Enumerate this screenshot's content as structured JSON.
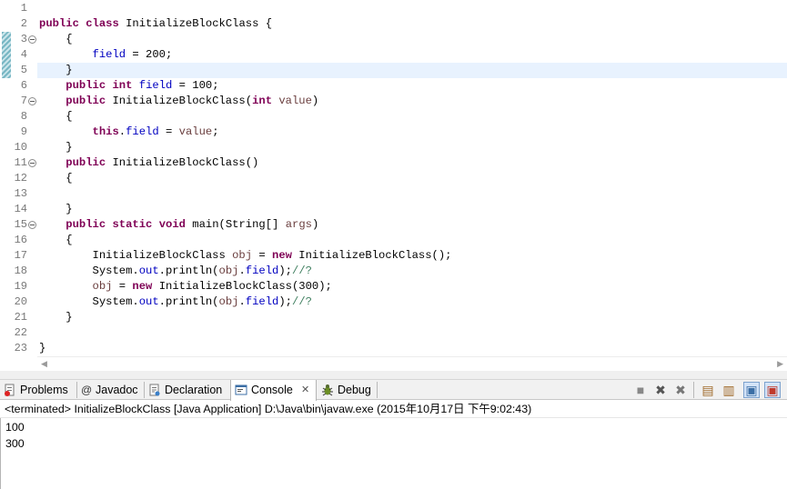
{
  "editor": {
    "line_numbers": [
      "1",
      "2",
      "3",
      "4",
      "5",
      "6",
      "7",
      "8",
      "9",
      "10",
      "11",
      "12",
      "13",
      "14",
      "15",
      "16",
      "17",
      "18",
      "19",
      "20",
      "21",
      "22",
      "23"
    ],
    "lines": [
      [],
      [
        {
          "t": "public",
          "c": "kw"
        },
        {
          "t": " "
        },
        {
          "t": "class",
          "c": "kw"
        },
        {
          "t": " InitializeBlockClass {"
        }
      ],
      [
        {
          "t": "    {"
        }
      ],
      [
        {
          "t": "        "
        },
        {
          "t": "field",
          "c": "fld"
        },
        {
          "t": " = 200;"
        }
      ],
      [
        {
          "t": "    }"
        }
      ],
      [
        {
          "t": "    "
        },
        {
          "t": "public",
          "c": "kw"
        },
        {
          "t": " "
        },
        {
          "t": "int",
          "c": "kw"
        },
        {
          "t": " "
        },
        {
          "t": "field",
          "c": "fld"
        },
        {
          "t": " = 100;"
        }
      ],
      [
        {
          "t": "    "
        },
        {
          "t": "public",
          "c": "kw"
        },
        {
          "t": " InitializeBlockClass("
        },
        {
          "t": "int",
          "c": "kw"
        },
        {
          "t": " "
        },
        {
          "t": "value",
          "c": "var"
        },
        {
          "t": ")"
        }
      ],
      [
        {
          "t": "    {"
        }
      ],
      [
        {
          "t": "        "
        },
        {
          "t": "this",
          "c": "kw"
        },
        {
          "t": "."
        },
        {
          "t": "field",
          "c": "fld"
        },
        {
          "t": " = "
        },
        {
          "t": "value",
          "c": "var"
        },
        {
          "t": ";"
        }
      ],
      [
        {
          "t": "    }"
        }
      ],
      [
        {
          "t": "    "
        },
        {
          "t": "public",
          "c": "kw"
        },
        {
          "t": " InitializeBlockClass()"
        }
      ],
      [
        {
          "t": "    {"
        }
      ],
      [],
      [
        {
          "t": "    }"
        }
      ],
      [
        {
          "t": "    "
        },
        {
          "t": "public",
          "c": "kw"
        },
        {
          "t": " "
        },
        {
          "t": "static",
          "c": "kw"
        },
        {
          "t": " "
        },
        {
          "t": "void",
          "c": "kw"
        },
        {
          "t": " main(String[] "
        },
        {
          "t": "args",
          "c": "var"
        },
        {
          "t": ")"
        }
      ],
      [
        {
          "t": "    {"
        }
      ],
      [
        {
          "t": "        InitializeBlockClass "
        },
        {
          "t": "obj",
          "c": "var"
        },
        {
          "t": " = "
        },
        {
          "t": "new",
          "c": "kw"
        },
        {
          "t": " InitializeBlockClass();"
        }
      ],
      [
        {
          "t": "        System."
        },
        {
          "t": "out",
          "c": "fld"
        },
        {
          "t": ".println("
        },
        {
          "t": "obj",
          "c": "var"
        },
        {
          "t": "."
        },
        {
          "t": "field",
          "c": "fld"
        },
        {
          "t": ");"
        },
        {
          "t": "//?",
          "c": "cmt"
        }
      ],
      [
        {
          "t": "        "
        },
        {
          "t": "obj",
          "c": "var"
        },
        {
          "t": " = "
        },
        {
          "t": "new",
          "c": "kw"
        },
        {
          "t": " InitializeBlockClass(300);"
        }
      ],
      [
        {
          "t": "        System."
        },
        {
          "t": "out",
          "c": "fld"
        },
        {
          "t": ".println("
        },
        {
          "t": "obj",
          "c": "var"
        },
        {
          "t": "."
        },
        {
          "t": "field",
          "c": "fld"
        },
        {
          "t": ");"
        },
        {
          "t": "//?",
          "c": "cmt"
        }
      ],
      [
        {
          "t": "    }"
        }
      ],
      [],
      [
        {
          "t": "}"
        }
      ]
    ],
    "fold_lines": [
      "3",
      "7",
      "11",
      "15"
    ]
  },
  "tabs": [
    {
      "label": "Problems",
      "icon": "problems-icon",
      "active": false
    },
    {
      "label": "Javadoc",
      "icon": "javadoc-at-icon",
      "active": false
    },
    {
      "label": "Declaration",
      "icon": "declaration-icon",
      "active": false
    },
    {
      "label": "Console",
      "icon": "console-icon",
      "active": true
    },
    {
      "label": "Debug",
      "icon": "debug-bug-icon",
      "active": false
    }
  ],
  "toolbar": [
    {
      "name": "terminate-icon",
      "glyph": "■"
    },
    {
      "name": "remove-launch-icon",
      "glyph": "✖"
    },
    {
      "name": "remove-all-terminated-icon",
      "glyph": "✖"
    },
    {
      "name": "clear-console-icon",
      "glyph": "▤"
    },
    {
      "name": "scroll-lock-icon",
      "glyph": "▥"
    },
    {
      "name": "show-console-stdout-icon",
      "glyph": "▣"
    },
    {
      "name": "show-console-stderr-icon",
      "glyph": "▣"
    }
  ],
  "console": {
    "header": "<terminated> InitializeBlockClass [Java Application] D:\\Java\\bin\\javaw.exe (2015年10月17日 下午9:02:43)",
    "output": [
      "100",
      "300"
    ]
  },
  "colors": {
    "keyword": "#7f0055",
    "field": "#0000c0",
    "comment": "#3f7f5f",
    "local_var": "#6a3e3e",
    "current_line": "#e8f2fe"
  }
}
